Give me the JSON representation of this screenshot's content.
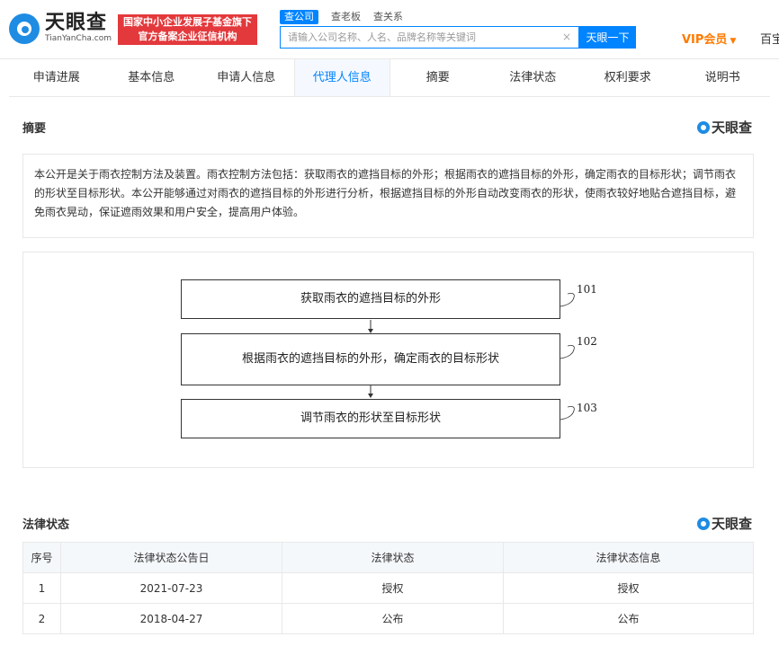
{
  "header": {
    "logo_cn": "天眼查",
    "logo_en": "TianYanCha.com",
    "gov_line1": "国家中小企业发展子基金旗下",
    "gov_line2": "官方备案企业征信机构",
    "search_tabs": [
      "查公司",
      "查老板",
      "查关系"
    ],
    "search_placeholder": "请输入公司名称、人名、品牌名称等关键词",
    "clear_glyph": "×",
    "search_button": "天眼一下",
    "vip_label": "VIP会员",
    "vip_arrow": "▼",
    "baike": "百宝"
  },
  "nav": {
    "tabs": [
      "申请进展",
      "基本信息",
      "申请人信息",
      "代理人信息",
      "摘要",
      "法律状态",
      "权利要求",
      "说明书"
    ],
    "active_index": 3
  },
  "abstract_section": {
    "title": "摘要",
    "brand": "天眼查",
    "text": "本公开是关于雨衣控制方法及装置。雨衣控制方法包括：获取雨衣的遮挡目标的外形；根据雨衣的遮挡目标的外形，确定雨衣的目标形状；调节雨衣的形状至目标形状。本公开能够通过对雨衣的遮挡目标的外形进行分析，根据遮挡目标的外形自动改变雨衣的形状，使雨衣较好地贴合遮挡目标，避免雨衣晃动，保证遮雨效果和用户安全，提高用户体验。"
  },
  "figure": {
    "steps": [
      {
        "label": "获取雨衣的遮挡目标的外形",
        "num": "101"
      },
      {
        "label": "根据雨衣的遮挡目标的外形，确定雨衣的目标形状",
        "num": "102"
      },
      {
        "label": "调节雨衣的形状至目标形状",
        "num": "103"
      }
    ]
  },
  "legal_section": {
    "title": "法律状态",
    "brand": "天眼查",
    "columns": [
      "序号",
      "法律状态公告日",
      "法律状态",
      "法律状态信息"
    ],
    "rows": [
      [
        "1",
        "2021-07-23",
        "授权",
        "授权"
      ],
      [
        "2",
        "2018-04-27",
        "公布",
        "公布"
      ]
    ]
  },
  "colors": {
    "brand_blue": "#0084ff",
    "badge_red": "#e3393c",
    "vip_orange": "#ff7a00"
  }
}
